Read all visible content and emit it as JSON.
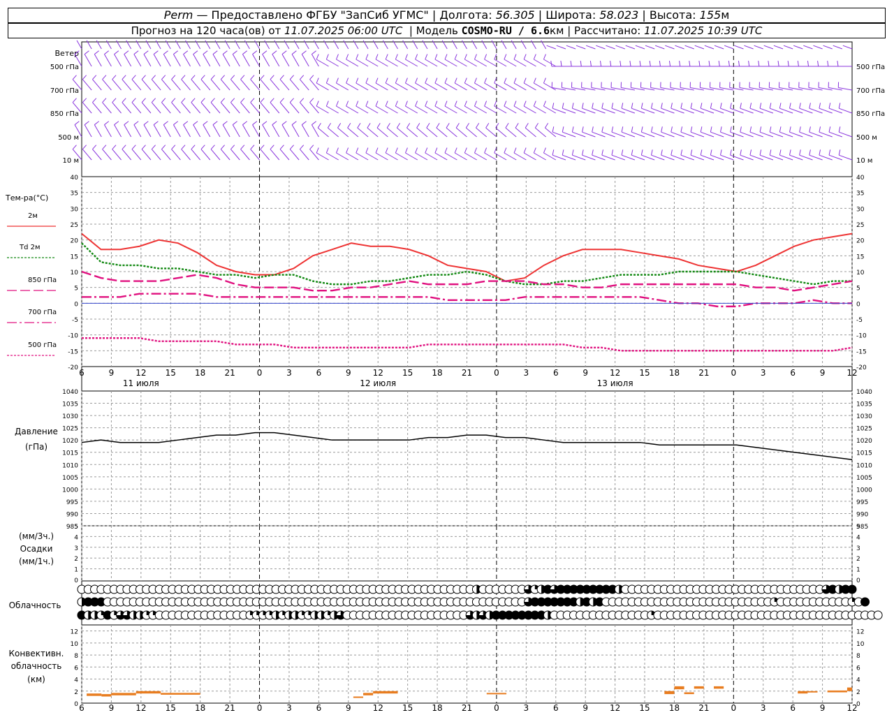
{
  "header": {
    "station": "Perm",
    "provider": "— Предоставлено ФГБУ \"ЗапСиб УГМС\"",
    "lon_label": "Долгота:",
    "lon": "56.305",
    "lat_label": "Широта:",
    "lat": "58.023",
    "alt_label": "Высота:",
    "alt": "155",
    "alt_unit": "м",
    "forecast_label": "Прогноз на 120 часа(ов) от",
    "issue_time": "11.07.2025 06:00 UTC",
    "model_label": "Модель",
    "model": "COSMO-RU / 6.6",
    "model_unit": "км",
    "calc_label": "Рассчитано:",
    "calc_time": "11.07.2025 10:39 UTC"
  },
  "colors": {
    "wind": "#8833dd",
    "t2m": "#ee3333",
    "td2m": "#118811",
    "levels": "#e0107f",
    "zero": "#3344cc",
    "pressure": "#000000",
    "conv": "#e87d20",
    "grid": "#999999"
  },
  "chart_data": [
    {
      "type": "wind_barbs",
      "side_label": "Ветер",
      "levels": [
        "500 гПа",
        "700 гПа",
        "850 гПа",
        "500 м",
        "10 м"
      ],
      "x_hours": {
        "start": 0,
        "end": 78,
        "step": 1
      },
      "direction_deg_by_level": [
        {
          "level": "500 гПа",
          "segments": [
            {
              "to_hour": 24,
              "dir": 330
            },
            {
              "to_hour": 48,
              "dir": 300
            },
            {
              "to_hour": 78,
              "dir": 270
            }
          ]
        },
        {
          "level": "700 гПа",
          "segments": [
            {
              "to_hour": 24,
              "dir": 320
            },
            {
              "to_hour": 48,
              "dir": 300
            },
            {
              "to_hour": 78,
              "dir": 280
            }
          ]
        },
        {
          "level": "850 гПа",
          "segments": [
            {
              "to_hour": 24,
              "dir": 320
            },
            {
              "to_hour": 48,
              "dir": 300
            },
            {
              "to_hour": 78,
              "dir": 290
            }
          ]
        },
        {
          "level": "500 м",
          "segments": [
            {
              "to_hour": 24,
              "dir": 330
            },
            {
              "to_hour": 48,
              "dir": 310
            },
            {
              "to_hour": 78,
              "dir": 290
            }
          ]
        },
        {
          "level": "10 м",
          "segments": [
            {
              "to_hour": 24,
              "dir": 320
            },
            {
              "to_hour": 48,
              "dir": 300
            },
            {
              "to_hour": 78,
              "dir": 290
            }
          ]
        }
      ]
    },
    {
      "type": "line",
      "side_label": "Тем-ра(°C)",
      "ylim": [
        -20,
        40
      ],
      "yticks": [
        40,
        35,
        30,
        25,
        20,
        15,
        10,
        5,
        0,
        -5,
        -10,
        -15,
        -20
      ],
      "x_labels": [
        "6",
        "9",
        "12",
        "15",
        "18",
        "21",
        "0",
        "3",
        "6",
        "9",
        "12",
        "15",
        "18",
        "21",
        "0",
        "3",
        "6",
        "9",
        "12",
        "15",
        "18",
        "21",
        "0",
        "3",
        "6",
        "9",
        "12"
      ],
      "day_labels": [
        {
          "hour": 6,
          "text": "11 июля"
        },
        {
          "hour": 30,
          "text": "12 июля"
        },
        {
          "hour": 54,
          "text": "13 июля"
        }
      ],
      "hour_step": 3,
      "series": [
        {
          "name": "2м",
          "style": "solid",
          "color_key": "t2m",
          "values": [
            22,
            17,
            17,
            18,
            20,
            19,
            16,
            12,
            10,
            9,
            9,
            11,
            15,
            17,
            19,
            18,
            18,
            17,
            15,
            12,
            11,
            10,
            7,
            8,
            12,
            15,
            17,
            17,
            17,
            16,
            15,
            14,
            12,
            11,
            10,
            12,
            15,
            18,
            20,
            21,
            22
          ]
        },
        {
          "name": "Td 2м",
          "style": "dotted",
          "color_key": "td2m",
          "values": [
            19,
            13,
            12,
            12,
            11,
            11,
            10,
            9,
            9,
            8,
            9,
            9,
            7,
            6,
            6,
            7,
            7,
            8,
            9,
            9,
            10,
            9,
            7,
            6,
            6,
            7,
            7,
            8,
            9,
            9,
            9,
            10,
            10,
            10,
            10,
            9,
            8,
            7,
            6,
            7,
            7
          ]
        },
        {
          "name": "850 гПа",
          "style": "dashed",
          "color_key": "levels",
          "values": [
            10,
            8,
            7,
            7,
            7,
            8,
            9,
            8,
            6,
            5,
            5,
            5,
            4,
            4,
            5,
            5,
            6,
            7,
            6,
            6,
            6,
            7,
            7,
            7,
            6,
            6,
            5,
            5,
            6,
            6,
            6,
            6,
            6,
            6,
            6,
            5,
            5,
            4,
            5,
            6,
            7
          ]
        },
        {
          "name": "700 гПа",
          "style": "dashdot",
          "color_key": "levels",
          "values": [
            2,
            2,
            2,
            3,
            3,
            3,
            3,
            2,
            2,
            2,
            2,
            2,
            2,
            2,
            2,
            2,
            2,
            2,
            2,
            1,
            1,
            1,
            1,
            2,
            2,
            2,
            2,
            2,
            2,
            2,
            1,
            0,
            0,
            -1,
            -1,
            0,
            0,
            0,
            1,
            0,
            0
          ]
        },
        {
          "name": "500 гПа",
          "style": "dotted",
          "color_key": "levels",
          "values": [
            -11,
            -11,
            -11,
            -11,
            -12,
            -12,
            -12,
            -12,
            -13,
            -13,
            -13,
            -14,
            -14,
            -14,
            -14,
            -14,
            -14,
            -14,
            -13,
            -13,
            -13,
            -13,
            -13,
            -13,
            -13,
            -13,
            -14,
            -14,
            -15,
            -15,
            -15,
            -15,
            -15,
            -15,
            -15,
            -15,
            -15,
            -15,
            -15,
            -15,
            -14
          ]
        },
        {
          "name": "0",
          "style": "thin",
          "color_key": "zero",
          "values_const": 0
        }
      ]
    },
    {
      "type": "line",
      "side_label_1": "Давление",
      "side_label_2": "(гПа)",
      "ylim": [
        985,
        1040
      ],
      "yticks": [
        1040,
        1035,
        1030,
        1025,
        1020,
        1015,
        1010,
        1005,
        1000,
        995,
        990,
        985
      ],
      "hour_step": 3,
      "series": [
        {
          "name": "Давление",
          "values": [
            1019,
            1020,
            1019,
            1019,
            1019,
            1020,
            1021,
            1022,
            1022,
            1023,
            1023,
            1022,
            1021,
            1020,
            1020,
            1020,
            1020,
            1020,
            1021,
            1021,
            1022,
            1022,
            1021,
            1021,
            1020,
            1019,
            1019,
            1019,
            1019,
            1019,
            1018,
            1018,
            1018,
            1018,
            1018,
            1017,
            1016,
            1015,
            1014,
            1013,
            1012
          ]
        }
      ]
    },
    {
      "type": "bar",
      "side_label_1": "(мм/3ч.)",
      "side_label_2": "Осадки",
      "side_label_3": "(мм/1ч.)",
      "ylim": [
        0,
        5
      ],
      "yticks": [
        5,
        4,
        3,
        2,
        1,
        0
      ],
      "values": []
    },
    {
      "type": "cloud_symbols",
      "side_label": "Облачность",
      "rows": [
        {
          "name": "upper",
          "hour_step": 1,
          "values": "0000000000000000000000000000000000000000000000000000000000000000000000000000000000000000000000000000000000000000000000000000"
        },
        {
          "name": "middle",
          "hour_step": 1,
          "values": "0000000000000000000000000000000000000000000000000000000000000000000000000000000000000000000000000000000000000000000000000000"
        },
        {
          "name": "lower",
          "hour_step": 1,
          "values": "0000000000000000000000000000000000000000000000000000000000000000000000000000000000000000000000000000000000000000000000000000"
        }
      ],
      "upper_fraction": [
        0,
        0,
        0,
        0,
        0,
        0,
        0,
        0,
        0,
        0,
        0,
        0,
        0,
        0,
        0,
        0,
        0,
        0,
        0,
        0,
        0,
        0,
        0,
        0,
        0,
        0,
        0,
        0,
        0,
        0,
        0,
        0,
        0,
        0,
        0,
        0,
        0,
        0,
        0,
        0,
        0,
        0,
        0,
        0,
        0,
        0,
        0,
        0,
        0,
        0,
        0,
        0,
        0,
        0,
        0,
        0,
        0,
        0,
        0,
        0,
        0,
        0.5,
        0,
        0,
        0,
        0,
        0,
        0,
        0,
        0.75,
        0.25,
        0.5,
        1,
        0.75,
        1,
        1,
        1,
        1,
        1,
        1,
        1,
        1,
        1,
        0.5,
        0,
        0,
        0,
        0,
        0,
        0,
        0,
        0,
        0,
        0,
        0,
        0,
        0,
        0,
        0,
        0,
        0,
        0,
        0,
        0,
        0,
        0,
        0,
        0,
        0,
        0,
        0,
        0,
        0,
        0,
        0,
        0.75,
        1,
        0.5,
        1,
        1
      ],
      "middle_fraction": [
        0.5,
        1,
        1,
        1,
        0,
        0,
        0,
        0,
        0,
        0,
        0,
        0,
        0,
        0,
        0,
        0,
        0,
        0,
        0,
        0,
        0,
        0,
        0,
        0,
        0,
        0,
        0,
        0,
        0,
        0,
        0,
        0,
        0,
        0,
        0,
        0,
        0,
        0,
        0,
        0,
        0,
        0,
        0,
        0,
        0,
        0,
        0,
        0,
        0,
        0,
        0,
        0,
        0,
        0,
        0,
        0,
        0,
        0,
        0,
        0,
        0,
        0,
        0,
        0,
        0,
        0,
        0,
        0,
        0,
        0.75,
        1,
        1,
        1,
        1,
        1,
        1,
        1,
        0.5,
        1,
        0.5,
        1,
        0,
        0,
        0,
        0,
        0,
        0,
        0,
        0,
        0,
        0,
        0,
        0,
        0,
        0,
        0,
        0,
        0,
        0,
        0,
        0,
        0,
        0,
        0,
        0,
        0,
        0,
        0.25,
        0,
        0,
        0,
        0,
        0,
        0,
        0,
        0,
        0,
        0,
        0,
        0.25,
        0,
        1
      ],
      "lower_fraction": [
        1,
        0.5,
        0.5,
        0.25,
        1,
        0.25,
        0.75,
        0.75,
        0.5,
        0.5,
        0.25,
        0.25,
        0,
        0,
        0,
        0,
        0,
        0,
        0,
        0,
        0,
        0,
        0,
        0,
        0,
        0,
        0.25,
        0.25,
        0.25,
        0.25,
        0.5,
        0.25,
        0.5,
        0.5,
        0.25,
        0.25,
        0.5,
        0.5,
        0.25,
        0.5,
        0.75,
        0,
        0,
        0,
        0,
        0,
        0,
        0,
        0,
        0,
        0,
        0,
        0,
        0,
        0,
        0,
        0,
        0,
        0,
        0,
        0.75,
        0.5,
        0.75,
        0.5,
        1,
        1,
        1,
        1,
        1,
        1,
        1,
        1,
        0.5,
        0,
        0,
        0,
        0,
        0,
        0,
        0,
        0,
        0,
        0,
        0,
        0,
        0,
        0,
        0,
        0.25,
        0,
        0,
        0,
        0,
        0,
        0,
        0,
        0,
        0,
        0,
        0,
        0,
        0,
        0,
        0,
        0,
        0,
        0,
        0,
        0,
        0,
        0,
        0,
        0,
        0,
        0,
        0,
        0,
        0,
        0,
        0,
        0,
        0,
        0,
        0
      ]
    },
    {
      "type": "bar_ranges",
      "side_label_1": "Конвективн.",
      "side_label_2": "облачность",
      "side_label_3": "(км)",
      "ylim": [
        0,
        13
      ],
      "yticks": [
        12,
        10,
        8,
        6,
        4,
        2,
        0
      ],
      "segments": [
        {
          "from_hour": 0.5,
          "to_hour": 2,
          "base": 1.2,
          "top": 1.6
        },
        {
          "from_hour": 2,
          "to_hour": 3,
          "base": 1.1,
          "top": 1.5
        },
        {
          "from_hour": 3,
          "to_hour": 5.5,
          "base": 1.3,
          "top": 1.7
        },
        {
          "from_hour": 5.5,
          "to_hour": 8,
          "base": 1.6,
          "top": 2.0
        },
        {
          "from_hour": 8,
          "to_hour": 12,
          "base": 1.4,
          "top": 1.7
        },
        {
          "from_hour": 27.5,
          "to_hour": 28.5,
          "base": 0.9,
          "top": 1.1
        },
        {
          "from_hour": 28.5,
          "to_hour": 29.5,
          "base": 1.3,
          "top": 1.7
        },
        {
          "from_hour": 29.5,
          "to_hour": 32,
          "base": 1.6,
          "top": 2.0
        },
        {
          "from_hour": 41,
          "to_hour": 43,
          "base": 1.5,
          "top": 1.7
        },
        {
          "from_hour": 59,
          "to_hour": 60,
          "base": 1.5,
          "top": 2.0
        },
        {
          "from_hour": 60,
          "to_hour": 61,
          "base": 2.3,
          "top": 2.8
        },
        {
          "from_hour": 61,
          "to_hour": 62,
          "base": 1.5,
          "top": 1.8
        },
        {
          "from_hour": 62,
          "to_hour": 63,
          "base": 2.4,
          "top": 2.8
        },
        {
          "from_hour": 64,
          "to_hour": 65,
          "base": 2.4,
          "top": 2.8
        },
        {
          "from_hour": 72.5,
          "to_hour": 73.5,
          "base": 1.6,
          "top": 2.0
        },
        {
          "from_hour": 73.5,
          "to_hour": 74.5,
          "base": 1.8,
          "top": 2.0
        },
        {
          "from_hour": 75.5,
          "to_hour": 77.5,
          "base": 1.8,
          "top": 2.1
        },
        {
          "from_hour": 77.5,
          "to_hour": 78,
          "base": 2.0,
          "top": 2.6
        }
      ]
    }
  ]
}
